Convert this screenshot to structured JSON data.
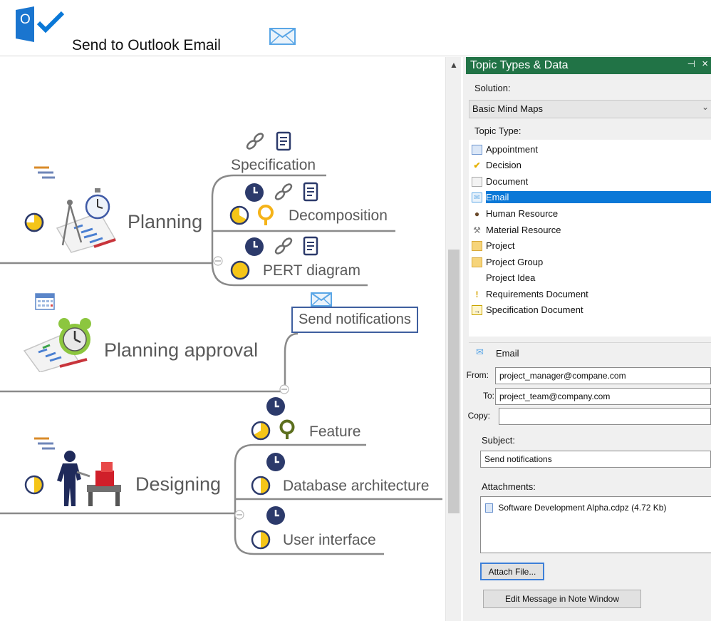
{
  "header": {
    "logo_letter": "O",
    "title": "Send to Outlook Email"
  },
  "mindmap": {
    "main_topics": [
      {
        "label": "Planning"
      },
      {
        "label": "Planning approval"
      },
      {
        "label": "Designing"
      }
    ],
    "subtopics": [
      {
        "label": "Specification"
      },
      {
        "label": "Decomposition"
      },
      {
        "label": "PERT diagram"
      },
      {
        "label": "Send notifications"
      },
      {
        "label": "Feature"
      },
      {
        "label": "Database architecture"
      },
      {
        "label": "User interface"
      }
    ],
    "selected_topic": "Send notifications",
    "icons": [
      "filter-icon",
      "clock-icon",
      "pie-progress-icon",
      "link-icon",
      "document-icon",
      "lightbulb-icon",
      "calendar-icon",
      "alarm-clock-icon",
      "mail-icon"
    ]
  },
  "panel": {
    "title": "Topic Types & Data",
    "pin_glyph": "⊣",
    "close_glyph": "×",
    "solution_label": "Solution:",
    "solution_value": "Basic Mind Maps",
    "topic_type_label": "Topic Type:",
    "topic_types": [
      {
        "label": "Appointment",
        "icon": "appointment-icon"
      },
      {
        "label": "Decision",
        "icon": "checkmark-icon"
      },
      {
        "label": "Document",
        "icon": "document-icon"
      },
      {
        "label": "Email",
        "icon": "email-icon",
        "selected": true
      },
      {
        "label": "Human Resource",
        "icon": "person-icon"
      },
      {
        "label": "Material Resource",
        "icon": "tools-icon"
      },
      {
        "label": "Project",
        "icon": "folder-icon"
      },
      {
        "label": "Project Group",
        "icon": "folder-group-icon"
      },
      {
        "label": "Project Idea",
        "icon": ""
      },
      {
        "label": "Requirements Document",
        "icon": "requirements-icon"
      },
      {
        "label": "Specification Document",
        "icon": "specification-icon"
      }
    ],
    "email": {
      "section_title": "Email",
      "from_label": "From:",
      "from_value": "project_manager@compane.com",
      "to_label": "To:",
      "to_value": "project_team@company.com",
      "copy_label": "Copy:",
      "copy_value": "",
      "subject_label": "Subject:",
      "subject_value": "Send notifications",
      "attachments_label": "Attachments:",
      "attachment_file": "Software Development Alpha.cdpz (4.72 Kb)",
      "attach_button": "Attach File...",
      "edit_button": "Edit Message in Note Window"
    }
  },
  "colors": {
    "panel_title_bg": "#217346",
    "selection_blue": "#0a78d7",
    "clock_navy": "#2c3a6b",
    "progress_yellow": "#f5c518",
    "map_line": "#8a8a8a",
    "outlook_blue": "#0a78d7"
  }
}
